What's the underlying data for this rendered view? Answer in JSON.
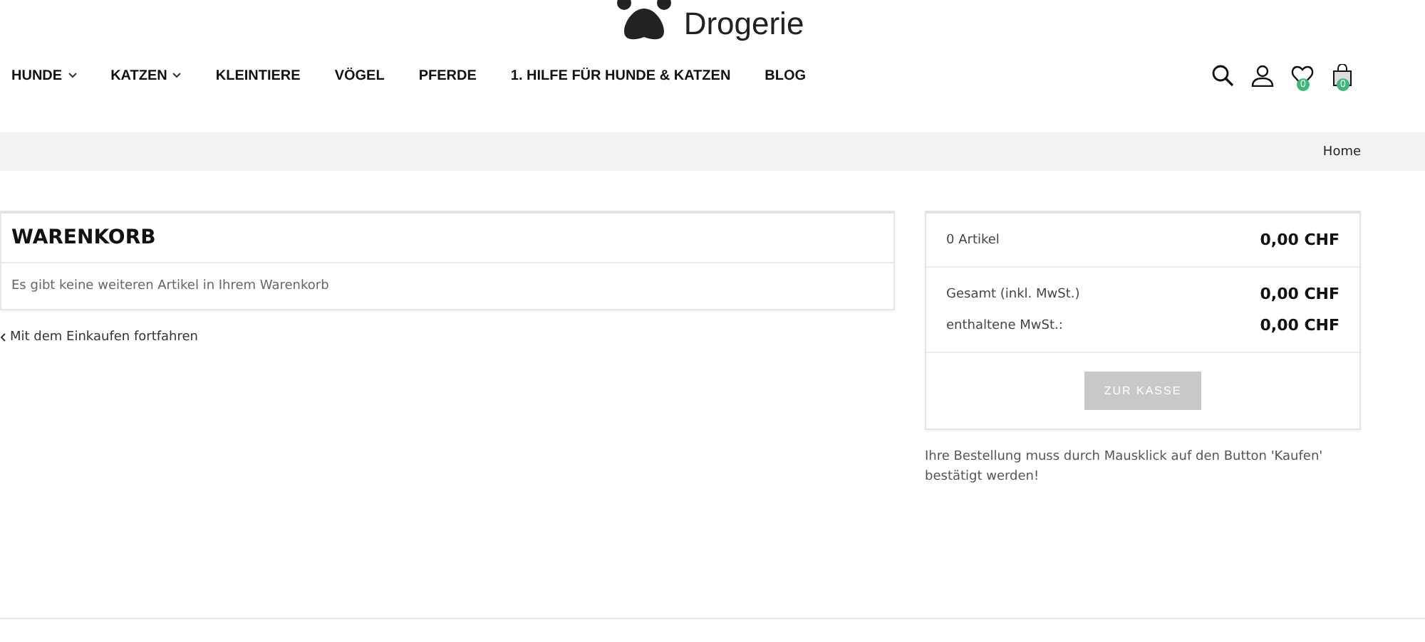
{
  "logo": {
    "text": "Drogerie"
  },
  "nav": [
    {
      "label": "HUNDE",
      "dropdown": true
    },
    {
      "label": "KATZEN",
      "dropdown": true
    },
    {
      "label": "KLEINTIERE",
      "dropdown": false
    },
    {
      "label": "VÖGEL",
      "dropdown": false
    },
    {
      "label": "PFERDE",
      "dropdown": false
    },
    {
      "label": "1. HILFE FÜR HUNDE & KATZEN",
      "dropdown": false
    },
    {
      "label": "BLOG",
      "dropdown": false
    }
  ],
  "header_icons": [
    {
      "kind": "search"
    },
    {
      "kind": "account"
    },
    {
      "kind": "wishlist",
      "badge": "0"
    },
    {
      "kind": "cart",
      "badge": "0"
    }
  ],
  "breadcrumb": [
    "Home"
  ],
  "cart": {
    "title": "WARENKORB",
    "empty_message": "Es gibt keine weiteren Artikel in Ihrem Warenkorb",
    "continue_link": "Mit dem Einkaufen fortfahren"
  },
  "summary": {
    "items_label": "0 Artikel",
    "items_value": "0,00 CHF",
    "totals": [
      {
        "label": "Gesamt (inkl. MwSt.)",
        "value": "0,00 CHF"
      },
      {
        "label": "enthaltene MwSt.:",
        "value": "0,00 CHF"
      }
    ],
    "checkout_button": {
      "label": "ZUR KASSE",
      "disabled": true
    },
    "note": "Ihre Bestellung muss durch Mausklick auf den Button 'Kaufen' bestätigt werden!"
  }
}
